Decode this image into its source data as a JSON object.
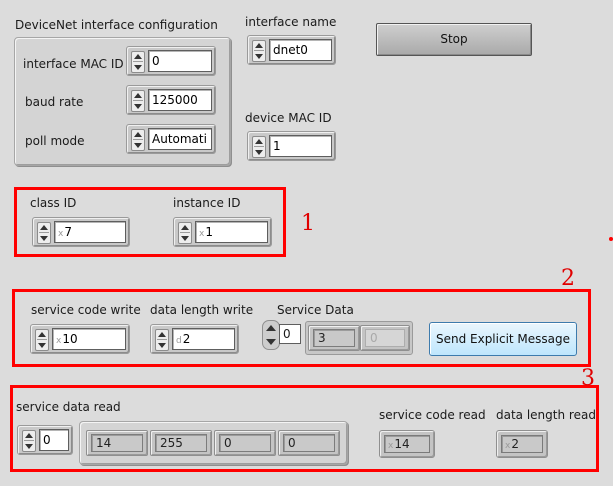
{
  "config": {
    "title": "DeviceNet interface configuration",
    "mac_id": {
      "label": "interface MAC ID",
      "value": "0"
    },
    "baud_rate": {
      "label": "baud rate",
      "value": "125000"
    },
    "poll_mode": {
      "label": "poll mode",
      "value": "Automati"
    }
  },
  "interface_name": {
    "label": "interface name",
    "value": "dnet0"
  },
  "device_mac_id": {
    "label": "device MAC ID",
    "value": "1"
  },
  "stop_button": {
    "label": "Stop"
  },
  "section1": {
    "annotation": "1",
    "class_id": {
      "label": "class ID",
      "radix": "x",
      "value": "7"
    },
    "instance_id": {
      "label": "instance ID",
      "radix": "x",
      "value": "1"
    }
  },
  "section2": {
    "annotation": "2",
    "service_code_write": {
      "label": "service code write",
      "radix": "x",
      "value": "10"
    },
    "data_length_write": {
      "label": "data length write",
      "radix": "d",
      "value": "2"
    },
    "service_data": {
      "label": "Service Data",
      "index": "0",
      "values": [
        "3",
        "0"
      ]
    },
    "send_button": {
      "label": "Send Explicit Message"
    }
  },
  "section3": {
    "annotation": "3",
    "service_data_read": {
      "label": "service data read",
      "index": "0",
      "values": [
        "14",
        "255",
        "0",
        "0"
      ]
    },
    "service_code_read": {
      "label": "service code read",
      "radix": "x",
      "value": "14"
    },
    "data_length_read": {
      "label": "data length read",
      "radix": "x",
      "value": "2"
    }
  },
  "colors": {
    "annotation_red": "#ff0000",
    "send_button_blue": "#bee6fd"
  }
}
